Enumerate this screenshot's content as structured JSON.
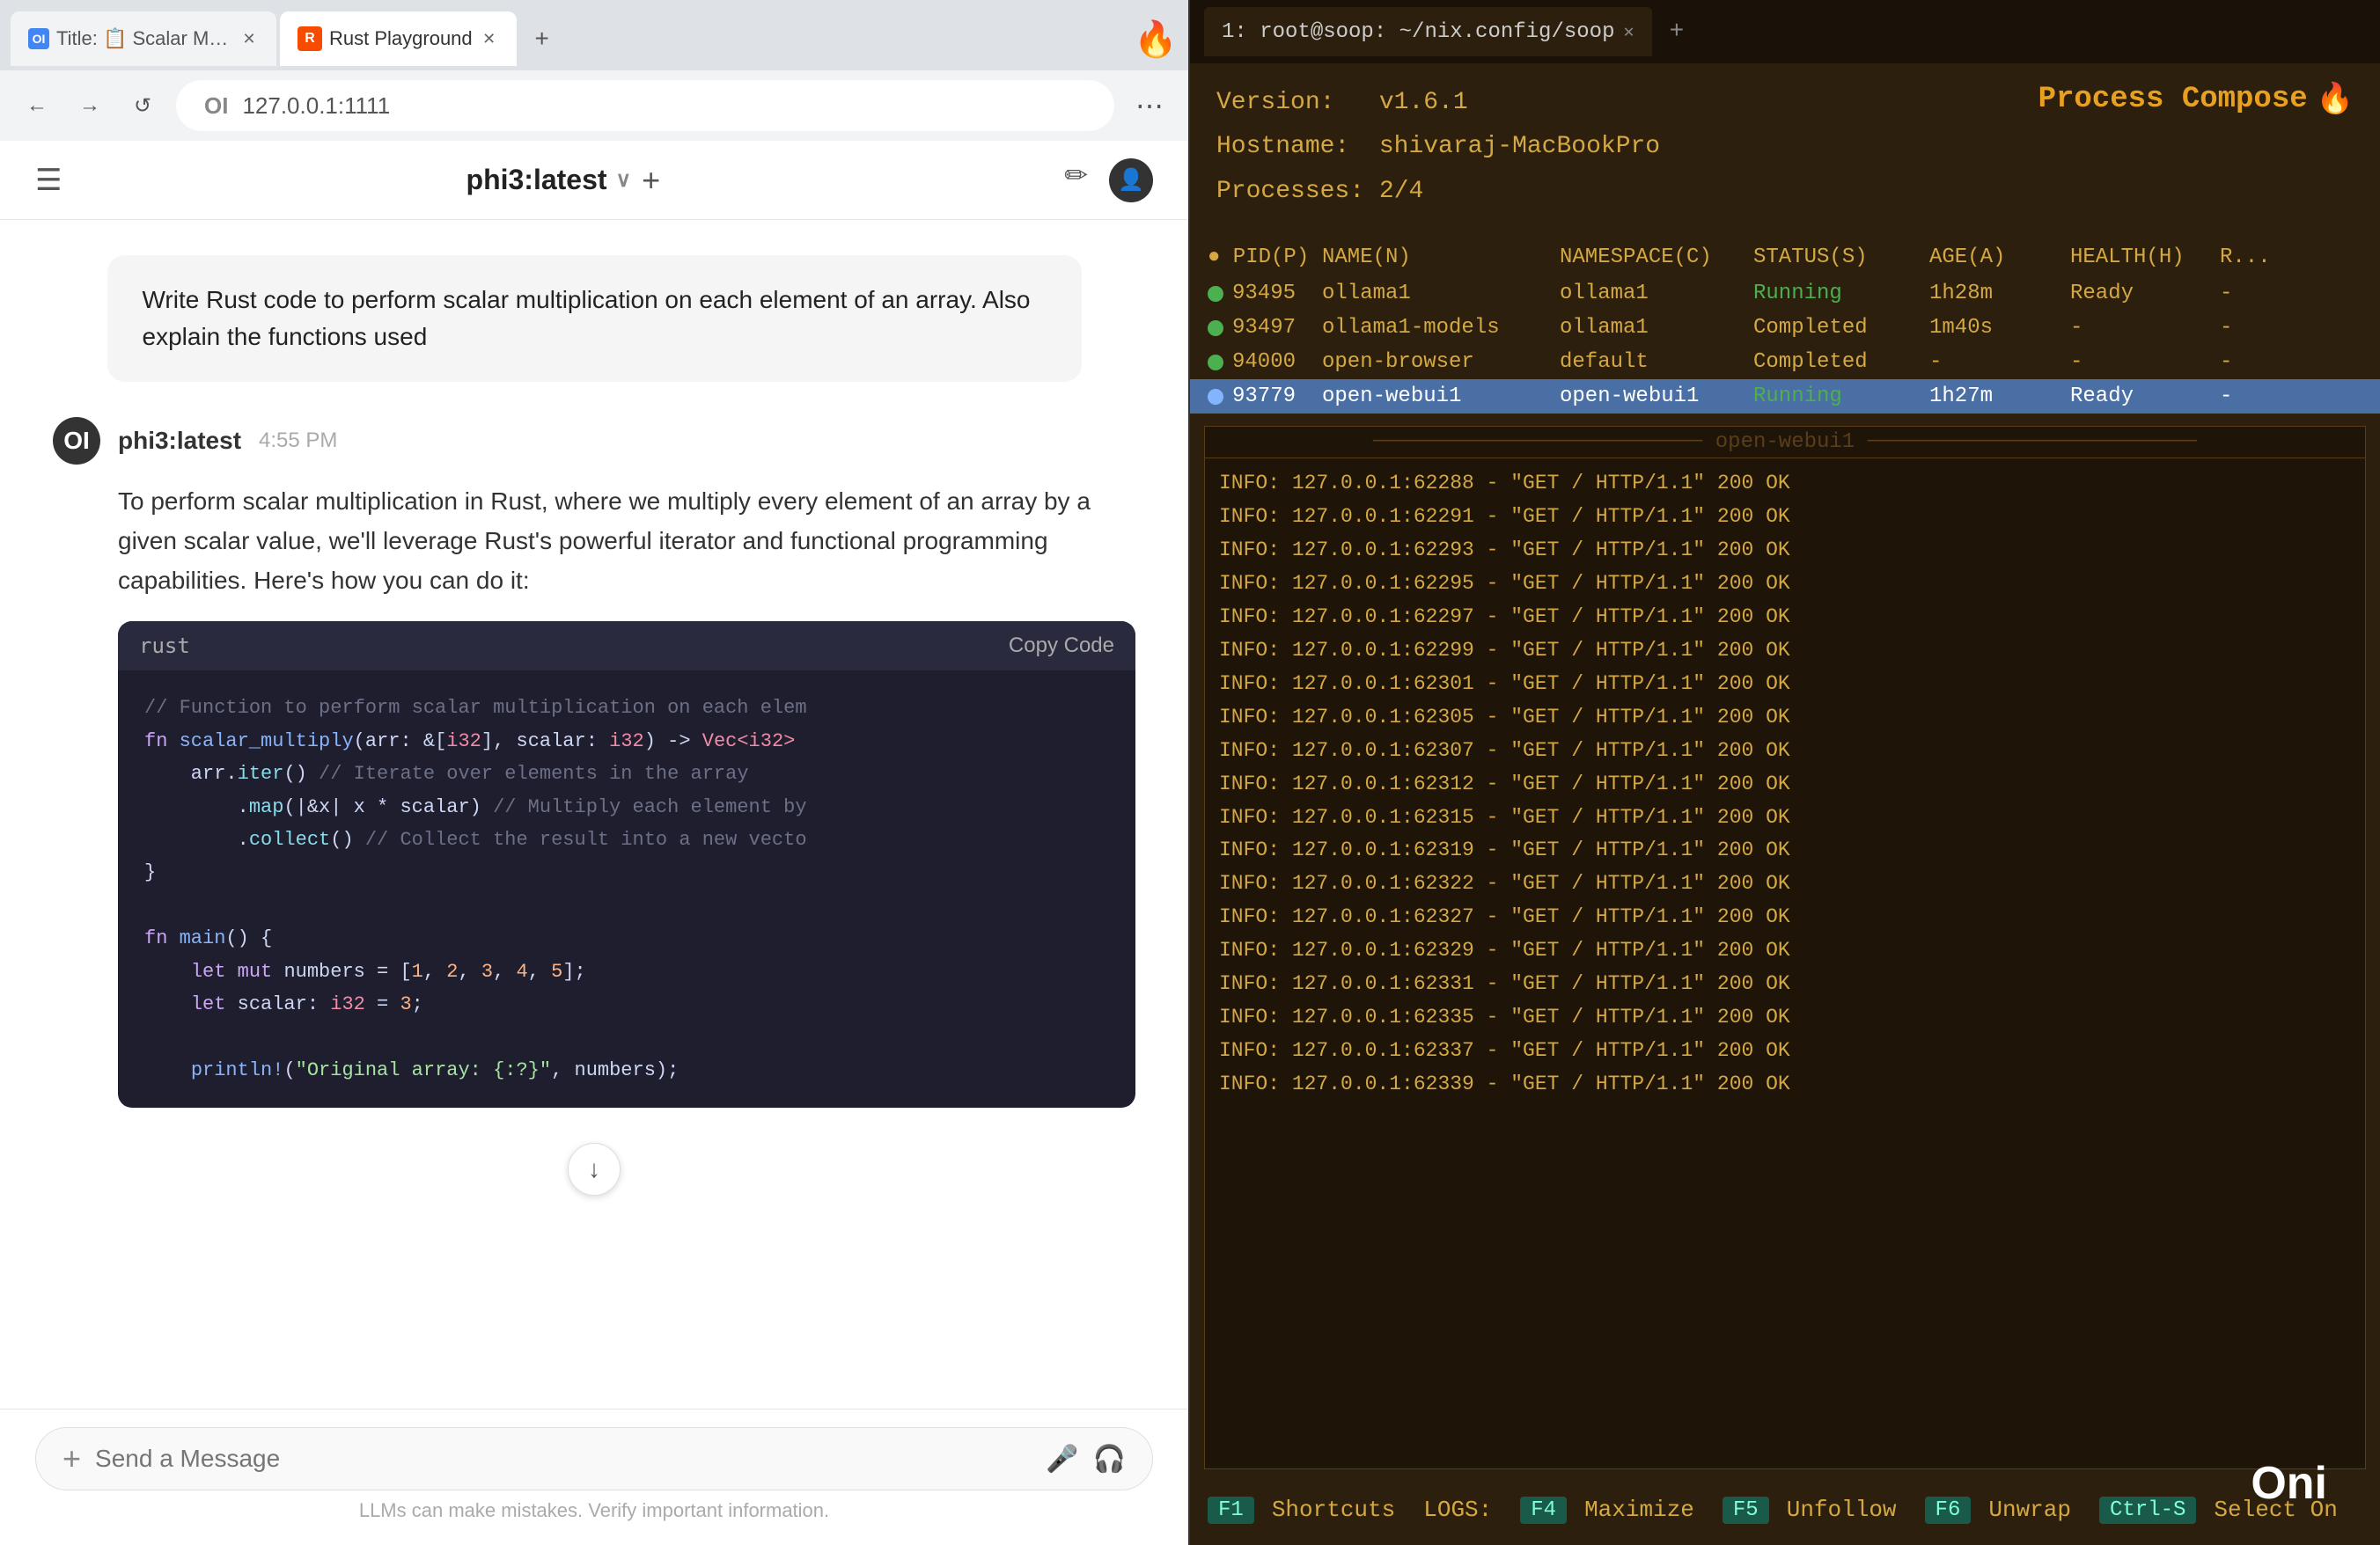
{
  "browser": {
    "tabs": [
      {
        "id": "tab1",
        "favicon": "OI",
        "label": "Title: 📋 Scalar Multiply Arr...",
        "active": false
      },
      {
        "id": "tab2",
        "favicon": "R",
        "label": "Rust Playground",
        "active": true
      }
    ],
    "new_tab_label": "+",
    "flame_icon": "🔥",
    "nav": {
      "back_label": "←",
      "forward_label": "→",
      "refresh_label": "↺"
    },
    "url": "127.0.0.1:1111",
    "url_prefix": "OI",
    "menu_label": "⋯"
  },
  "chat": {
    "header": {
      "hamburger_label": "☰",
      "model_name": "phi3:latest",
      "chevron": "∨",
      "plus_label": "+",
      "edit_icon": "✏",
      "avatar_label": "👤"
    },
    "user_message": "Write Rust code to perform scalar multiplication on each element of an array. Also explain the functions used",
    "assistant": {
      "avatar": "OI",
      "name": "phi3:latest",
      "time": "4:55 PM",
      "intro": "To perform scalar multiplication in Rust, where we multiply every element of an array by a given scalar value, we'll leverage Rust's powerful iterator and functional programming capabilities. Here's how you can do it:",
      "code_lang": "rust",
      "copy_label": "Copy Code",
      "code_lines": [
        {
          "type": "comment",
          "text": "// Function to perform scalar multiplication on each elem"
        },
        {
          "type": "mixed",
          "parts": [
            {
              "t": "keyword",
              "v": "fn "
            },
            {
              "t": "fn",
              "v": "scalar_multiply"
            },
            {
              "t": "plain",
              "v": "(arr: &["
            },
            {
              "t": "type",
              "v": "i32"
            },
            {
              "t": "plain",
              "v": "], scalar: "
            },
            {
              "t": "type",
              "v": "i32"
            },
            {
              "t": "plain",
              "v": ") -> "
            },
            {
              "t": "type",
              "v": "Vec<i32>"
            }
          ]
        },
        {
          "type": "mixed",
          "parts": [
            {
              "t": "plain",
              "v": "    arr."
            },
            {
              "t": "method",
              "v": "iter"
            },
            {
              "t": "plain",
              "v": "() "
            },
            {
              "t": "comment",
              "v": "// Iterate over elements in the array"
            }
          ]
        },
        {
          "type": "mixed",
          "parts": [
            {
              "t": "plain",
              "v": "        ."
            },
            {
              "t": "method",
              "v": "map"
            },
            {
              "t": "plain",
              "v": "(|&x| x * scalar) "
            },
            {
              "t": "comment",
              "v": "// Multiply each element by"
            }
          ]
        },
        {
          "type": "mixed",
          "parts": [
            {
              "t": "plain",
              "v": "        ."
            },
            {
              "t": "method",
              "v": "collect"
            },
            {
              "t": "plain",
              "v": "() "
            },
            {
              "t": "comment",
              "v": "// Collect the result into a new vecto"
            }
          ]
        },
        {
          "type": "plain",
          "text": "}"
        },
        {
          "type": "blank"
        },
        {
          "type": "mixed",
          "parts": [
            {
              "t": "keyword",
              "v": "fn "
            },
            {
              "t": "fn",
              "v": "main"
            },
            {
              "t": "plain",
              "v": "() {"
            }
          ]
        },
        {
          "type": "mixed",
          "parts": [
            {
              "t": "plain",
              "v": "    "
            },
            {
              "t": "keyword",
              "v": "let mut "
            },
            {
              "t": "plain",
              "v": "numbers = ["
            },
            {
              "t": "number",
              "v": "1"
            },
            {
              "t": "plain",
              "v": ", "
            },
            {
              "t": "number",
              "v": "2"
            },
            {
              "t": "plain",
              "v": ", "
            },
            {
              "t": "number",
              "v": "3"
            },
            {
              "t": "plain",
              "v": ", "
            },
            {
              "t": "number",
              "v": "4"
            },
            {
              "t": "plain",
              "v": ", "
            },
            {
              "t": "number",
              "v": "5"
            },
            {
              "t": "plain",
              "v": "];"
            }
          ]
        },
        {
          "type": "mixed",
          "parts": [
            {
              "t": "plain",
              "v": "    "
            },
            {
              "t": "keyword",
              "v": "let "
            },
            {
              "t": "plain",
              "v": "scalar: "
            },
            {
              "t": "type",
              "v": "i32"
            },
            {
              "t": "plain",
              "v": " = "
            },
            {
              "t": "number",
              "v": "3"
            },
            {
              "t": "plain",
              "v": ";"
            }
          ]
        },
        {
          "type": "blank"
        },
        {
          "type": "mixed",
          "parts": [
            {
              "t": "plain",
              "v": "    "
            },
            {
              "t": "fn",
              "v": "println!"
            },
            {
              "t": "plain",
              "v": "("
            },
            {
              "t": "string",
              "v": "\"Original array: {:?}\""
            },
            {
              "t": "plain",
              "v": ", numbers);"
            }
          ]
        }
      ],
      "scroll_down_icon": "↓"
    },
    "input": {
      "plus_label": "+",
      "placeholder": "Send a Message",
      "mic_icon": "🎤",
      "headphone_icon": "🎧"
    },
    "disclaimer": "LLMs can make mistakes. Verify important information."
  },
  "terminal": {
    "tab_label": "1: root@soop: ~/nix.config/soop",
    "tab_close": "✕",
    "new_tab": "+",
    "pc": {
      "version_label": "Version:",
      "version_value": "v1.6.1",
      "title": "Process Compose",
      "flame": "🔥",
      "hostname_label": "Hostname:",
      "hostname_value": "shivaraj-MacBookPro",
      "processes_label": "Processes:",
      "processes_value": "2/4"
    },
    "table_headers": {
      "pid": "● PID(P)",
      "name": "NAME(N)",
      "namespace": "NAMESPACE(C)",
      "status": "STATUS(S)",
      "age": "AGE(A)",
      "health": "HEALTH(H)",
      "r": "R..."
    },
    "processes": [
      {
        "dot": "running",
        "pid": "93495",
        "name": "ollama1",
        "namespace": "ollama1",
        "status": "Running",
        "age": "1h28m",
        "health": "Ready",
        "r": "-"
      },
      {
        "dot": "completed",
        "pid": "93497",
        "name": "ollama1-models",
        "namespace": "ollama1",
        "status": "Completed",
        "age": "1m40s",
        "health": "-",
        "r": "-"
      },
      {
        "dot": "completed",
        "pid": "94000",
        "name": "open-browser",
        "namespace": "default",
        "status": "Completed",
        "age": "-",
        "health": "-",
        "r": "-"
      },
      {
        "dot": "selected",
        "pid": "93779",
        "name": "open-webui1",
        "namespace": "open-webui1",
        "status": "Running",
        "age": "1h27m",
        "health": "Ready",
        "r": "-",
        "selected": true
      }
    ],
    "log_title": "open-webui1",
    "log_lines": [
      "INFO:      127.0.0.1:62288 - \"GET / HTTP/1.1\" 200 OK",
      "INFO:      127.0.0.1:62291 - \"GET / HTTP/1.1\" 200 OK",
      "INFO:      127.0.0.1:62293 - \"GET / HTTP/1.1\" 200 OK",
      "INFO:      127.0.0.1:62295 - \"GET / HTTP/1.1\" 200 OK",
      "INFO:      127.0.0.1:62297 - \"GET / HTTP/1.1\" 200 OK",
      "INFO:      127.0.0.1:62299 - \"GET / HTTP/1.1\" 200 OK",
      "INFO:      127.0.0.1:62301 - \"GET / HTTP/1.1\" 200 OK",
      "INFO:      127.0.0.1:62305 - \"GET / HTTP/1.1\" 200 OK",
      "INFO:      127.0.0.1:62307 - \"GET / HTTP/1.1\" 200 OK",
      "INFO:      127.0.0.1:62312 - \"GET / HTTP/1.1\" 200 OK",
      "INFO:      127.0.0.1:62315 - \"GET / HTTP/1.1\" 200 OK",
      "INFO:      127.0.0.1:62319 - \"GET / HTTP/1.1\" 200 OK",
      "INFO:      127.0.0.1:62322 - \"GET / HTTP/1.1\" 200 OK",
      "INFO:      127.0.0.1:62327 - \"GET / HTTP/1.1\" 200 OK",
      "INFO:      127.0.0.1:62329 - \"GET / HTTP/1.1\" 200 OK",
      "INFO:      127.0.0.1:62331 - \"GET / HTTP/1.1\" 200 OK",
      "INFO:      127.0.0.1:62335 - \"GET / HTTP/1.1\" 200 OK",
      "INFO:      127.0.0.1:62337 - \"GET / HTTP/1.1\" 200 OK",
      "INFO:      127.0.0.1:62339 - \"GET / HTTP/1.1\" 200 OK"
    ],
    "shortcuts": [
      {
        "key": "F1",
        "label": "Shortcuts"
      },
      {
        "key": "LOGS:",
        "label": ""
      },
      {
        "key": "F4",
        "label": "Maximize"
      },
      {
        "key": "F5",
        "label": "Unfollow"
      },
      {
        "key": "F6",
        "label": "Unwrap"
      },
      {
        "key": "Ctrl-S",
        "label": "Select On"
      }
    ]
  },
  "oni_label": "Oni"
}
